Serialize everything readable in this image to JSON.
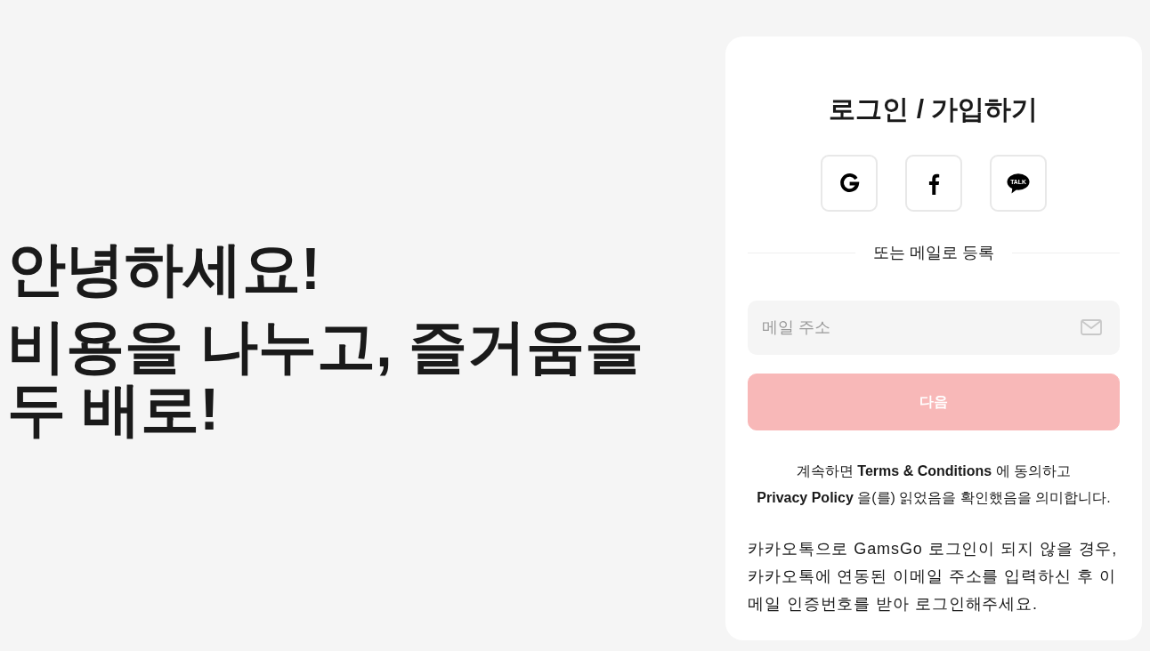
{
  "hero": {
    "greeting": "안녕하세요!",
    "tagline": "비용을 나누고, 즐거움을 두 배로!"
  },
  "login_card": {
    "title": "로그인 / 가입하기",
    "social_buttons": [
      {
        "kind": "google"
      },
      {
        "kind": "facebook"
      },
      {
        "kind": "kakaotalk",
        "icon_text": "TALK"
      }
    ],
    "divider_label": "또는 메일로 등록",
    "email_field": {
      "placeholder": "메일 주소"
    },
    "next_button": {
      "label": "다음",
      "disabled": true
    },
    "terms": [
      {
        "kind": "text",
        "text": "계속하면 "
      },
      {
        "kind": "link",
        "text": "Terms & Conditions"
      },
      {
        "kind": "text",
        "text": " 에 동의하고 "
      },
      {
        "kind": "link",
        "text": "Privacy Policy"
      },
      {
        "kind": "text",
        "text": " 을(를) 읽었음을 확인했음을 의미합니다."
      }
    ],
    "kakao_notice": "카카오톡으로 GamsGo 로그인이 되지 않을 경우, 카카오톡에 연동된 이메일 주소를 입력하신 후 이메일 인증번호를 받아 로그인해주세요."
  }
}
